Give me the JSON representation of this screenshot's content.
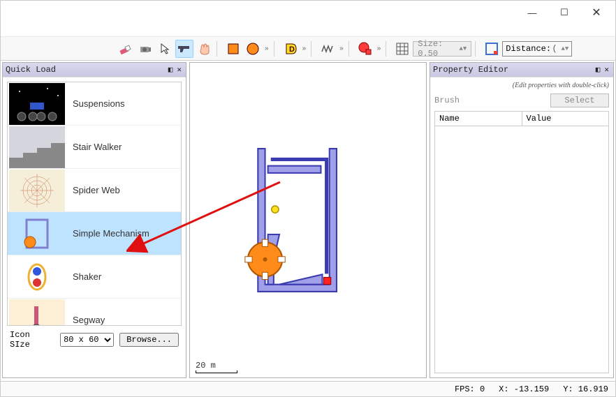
{
  "window": {
    "minimize": "—",
    "maximize": "☐",
    "close": "✕"
  },
  "toolbar": {
    "size_label": "Size: 0.50",
    "distance_label": "Distance:"
  },
  "quick_load": {
    "title": "Quick Load",
    "items": [
      {
        "label": "Suspensions"
      },
      {
        "label": "Stair Walker"
      },
      {
        "label": "Spider Web"
      },
      {
        "label": "Simple Mechanism"
      },
      {
        "label": "Shaker"
      },
      {
        "label": "Segway"
      }
    ],
    "icon_size_label": "Icon SIze",
    "icon_size_value": "80 x 60",
    "browse_label": "Browse..."
  },
  "canvas": {
    "scale": "20 m"
  },
  "property_editor": {
    "title": "Property Editor",
    "hint": "(Edit properties with double-click)",
    "brush_label": "Brush",
    "select_label": "Select",
    "col_name": "Name",
    "col_value": "Value"
  },
  "status": {
    "fps": "FPS: 0",
    "x": "X: -13.159",
    "y": "Y: 16.919"
  }
}
